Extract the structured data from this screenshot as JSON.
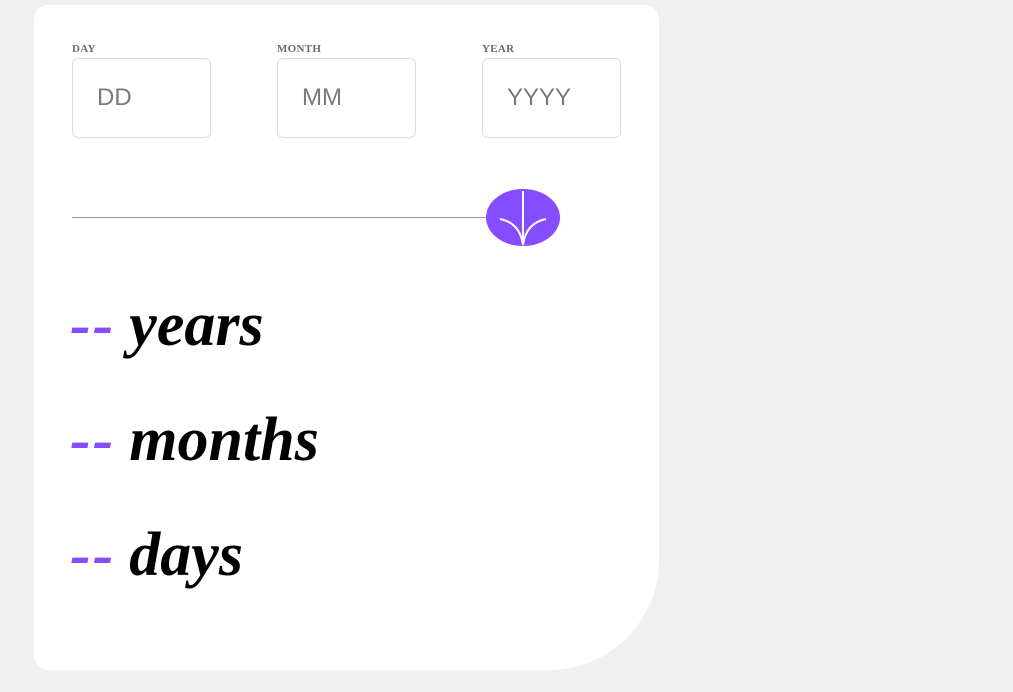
{
  "form": {
    "day": {
      "label": "DAY",
      "placeholder": "DD",
      "value": ""
    },
    "month": {
      "label": "MONTH",
      "placeholder": "MM",
      "value": ""
    },
    "year": {
      "label": "YEAR",
      "placeholder": "YYYY",
      "value": ""
    }
  },
  "submit": {
    "icon": "arrow-down-icon",
    "color": "#854dff"
  },
  "results": {
    "years": {
      "value": "--",
      "unit": "years"
    },
    "months": {
      "value": "--",
      "unit": "months"
    },
    "days": {
      "value": "--",
      "unit": "days"
    }
  },
  "colors": {
    "accent": "#854dff",
    "background": "#f0f0f0",
    "card": "#ffffff"
  }
}
